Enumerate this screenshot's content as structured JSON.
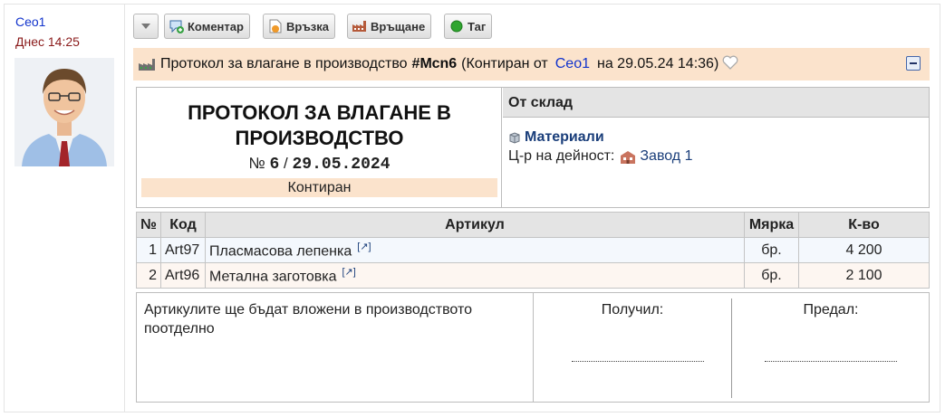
{
  "author": {
    "name": "Сео1",
    "time": "Днес 14:25"
  },
  "toolbar": {
    "comment_label": "Коментар",
    "link_label": "Връзка",
    "return_label": "Връщане",
    "tag_label": "Таг"
  },
  "header": {
    "title_prefix": "Протокол за влагане в производство",
    "doc_code": "#Мсn6",
    "status_prefix": "(Контиран от",
    "user": "Сео1",
    "status_suffix": "на 29.05.24 14:36)"
  },
  "document": {
    "title": "ПРОТОКОЛ ЗА ВЛАГАНЕ В ПРОИЗВОДСТВО",
    "number_sign": "№",
    "number": "6",
    "separator": "/",
    "date": "29.05.2024",
    "state": "Контиран"
  },
  "store": {
    "header": "От склад",
    "name": "Материали",
    "center_label": "Ц-р на дейност:",
    "center_value": "Завод 1"
  },
  "items": {
    "columns": [
      "№",
      "Код",
      "Артикул",
      "Мярка",
      "К-во"
    ],
    "rows": [
      {
        "no": "1",
        "code": "Art97",
        "name": "Пласмасова лепенка",
        "unit": "бр.",
        "qty": "4 200"
      },
      {
        "no": "2",
        "code": "Art96",
        "name": "Метална заготовка",
        "unit": "бр.",
        "qty": "2 100"
      }
    ]
  },
  "footer": {
    "note": "Артикулите ще бъдат вложени в производството поотделно",
    "received_label": "Получил:",
    "handed_label": "Предал:"
  },
  "colors": {
    "header_bg": "#fbe3cc",
    "link": "#1133cc",
    "time": "#8a1a1a",
    "table_head": "#e4e4e4"
  }
}
